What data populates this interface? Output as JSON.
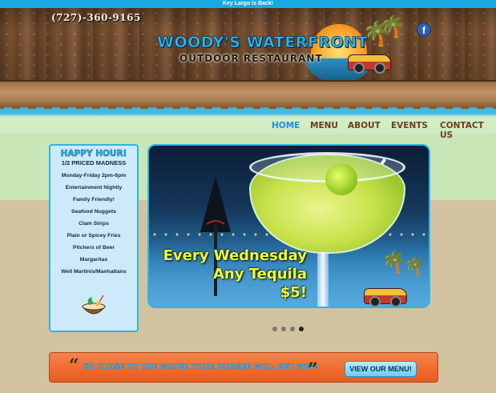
{
  "announcement": "Key Largo is Back!",
  "header": {
    "phone": "(727)-360-9165",
    "logo_title": "WOODY'S WATERFRONT",
    "logo_subtitle": "OUTDOOR RESTAURANT",
    "facebook_glyph": "f"
  },
  "nav": {
    "items": [
      "HOME",
      "MENU",
      "ABOUT",
      "EVENTS",
      "CONTACT US"
    ],
    "active": "HOME"
  },
  "happy_hour": {
    "title": "HAPPY HOUR!",
    "subtitle": "1/2 PRICED MADNESS",
    "items": [
      "Monday-Friday 2pm-6pm",
      "Entertainment Nightly",
      "Family Friendly!",
      "Seafood Nuggets",
      "Clam Strips",
      "Plain or Spicey Fries",
      "Pitchers of Beer",
      "Margaritas",
      "Well Martinis/Manhattans"
    ]
  },
  "slider": {
    "line1": "Every Wednesday",
    "line2": "Any Tequila",
    "line3": "$5!",
    "dots": 4,
    "active_dot": 4
  },
  "banner": {
    "text": "SO CLOSE TO THE WATER YOUR BURGER WILL GET WET!",
    "open_quote": "“",
    "close_quote": "”",
    "button": "VIEW OUR MENU!"
  },
  "colors": {
    "accent_blue": "#2eb4ea",
    "nav_brown": "#6b3f1e",
    "nav_active": "#1e8fd0",
    "banner_orange": "#ef6a2e",
    "promo_yellow": "#e8ff3a"
  }
}
